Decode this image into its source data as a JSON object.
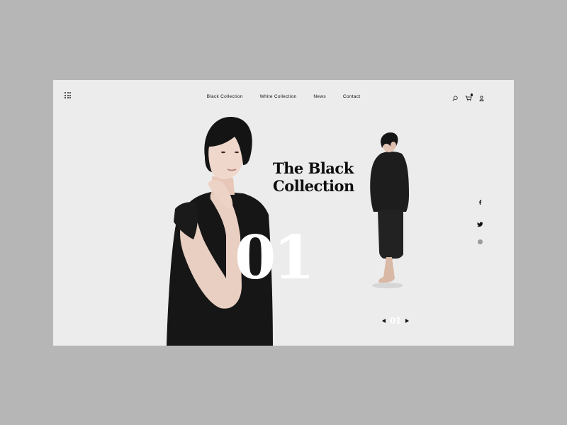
{
  "nav": {
    "items": [
      {
        "label": "Black Collection"
      },
      {
        "label": "White Collection"
      },
      {
        "label": "News"
      },
      {
        "label": "Contact"
      }
    ]
  },
  "header": {
    "icons": [
      "search-icon",
      "cart-icon",
      "user-icon"
    ]
  },
  "hero": {
    "title_line1": "The Black",
    "title_line2": "Collection",
    "number": "01"
  },
  "social": {
    "icons": [
      "facebook-icon",
      "twitter-icon",
      "dot-indicator"
    ]
  },
  "pager": {
    "current": "01"
  },
  "colors": {
    "background_outer": "#b6b6b6",
    "background_frame": "#ececec",
    "text_dark": "#0d0d0d",
    "number_white": "#ffffff"
  }
}
